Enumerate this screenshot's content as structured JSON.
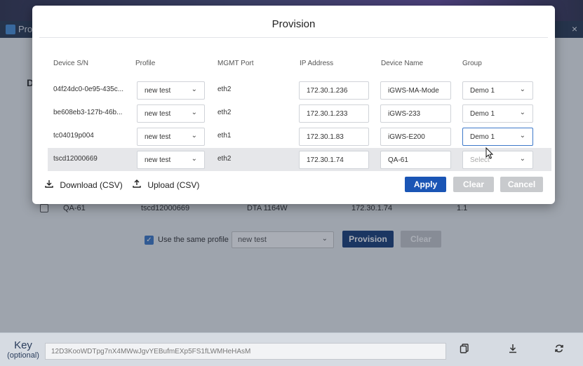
{
  "background_app": {
    "title": "Pro",
    "close_symbol": "×",
    "heading": "D",
    "row": {
      "name": "QA-61",
      "serial": "tscd12000669",
      "model": "DTA 1164W",
      "ip": "172.30.1.74",
      "version": "1.1"
    },
    "same_profile_label": "Use the same profile",
    "profile_select_value": "new test",
    "provision_label": "Provision",
    "clear_label": "Clear"
  },
  "keybar": {
    "label": "Key",
    "sublabel": "(optional)",
    "value": "12D3KooWDTpg7nX4MWwJgvYEBufmEXp5FS1fLWMHeHAsM",
    "icons": [
      "copy-icon",
      "download-icon",
      "refresh-icon"
    ]
  },
  "modal": {
    "title": "Provision",
    "columns": [
      "Device S/N",
      "Profile",
      "MGMT Port",
      "IP Address",
      "Device Name",
      "Group"
    ],
    "rows": [
      {
        "serial": "04f24dc0-0e95-435c...",
        "profile": "new test",
        "port": "eth2",
        "ip": "172.30.1.236",
        "name": "iGWS-MA-Mode",
        "group": "Demo 1"
      },
      {
        "serial": "be608eb3-127b-46b...",
        "profile": "new test",
        "port": "eth2",
        "ip": "172.30.1.233",
        "name": "iGWS-233",
        "group": "Demo 1"
      },
      {
        "serial": "tc04019p004",
        "profile": "new test",
        "port": "eth1",
        "ip": "172.30.1.83",
        "name": "iGWS-E200",
        "group": "Demo 1"
      },
      {
        "serial": "tscd12000669",
        "profile": "new test",
        "port": "eth2",
        "ip": "172.30.1.74",
        "name": "QA-61",
        "group": "Select"
      }
    ],
    "download_label": "Download (CSV)",
    "upload_label": "Upload (CSV)",
    "apply_label": "Apply",
    "clear_label": "Clear",
    "cancel_label": "Cancel"
  },
  "colors": {
    "primary": "#1a55b5",
    "navy": "#1a3f7a",
    "disabled": "#c8cacd",
    "focus": "#3e79c9"
  }
}
